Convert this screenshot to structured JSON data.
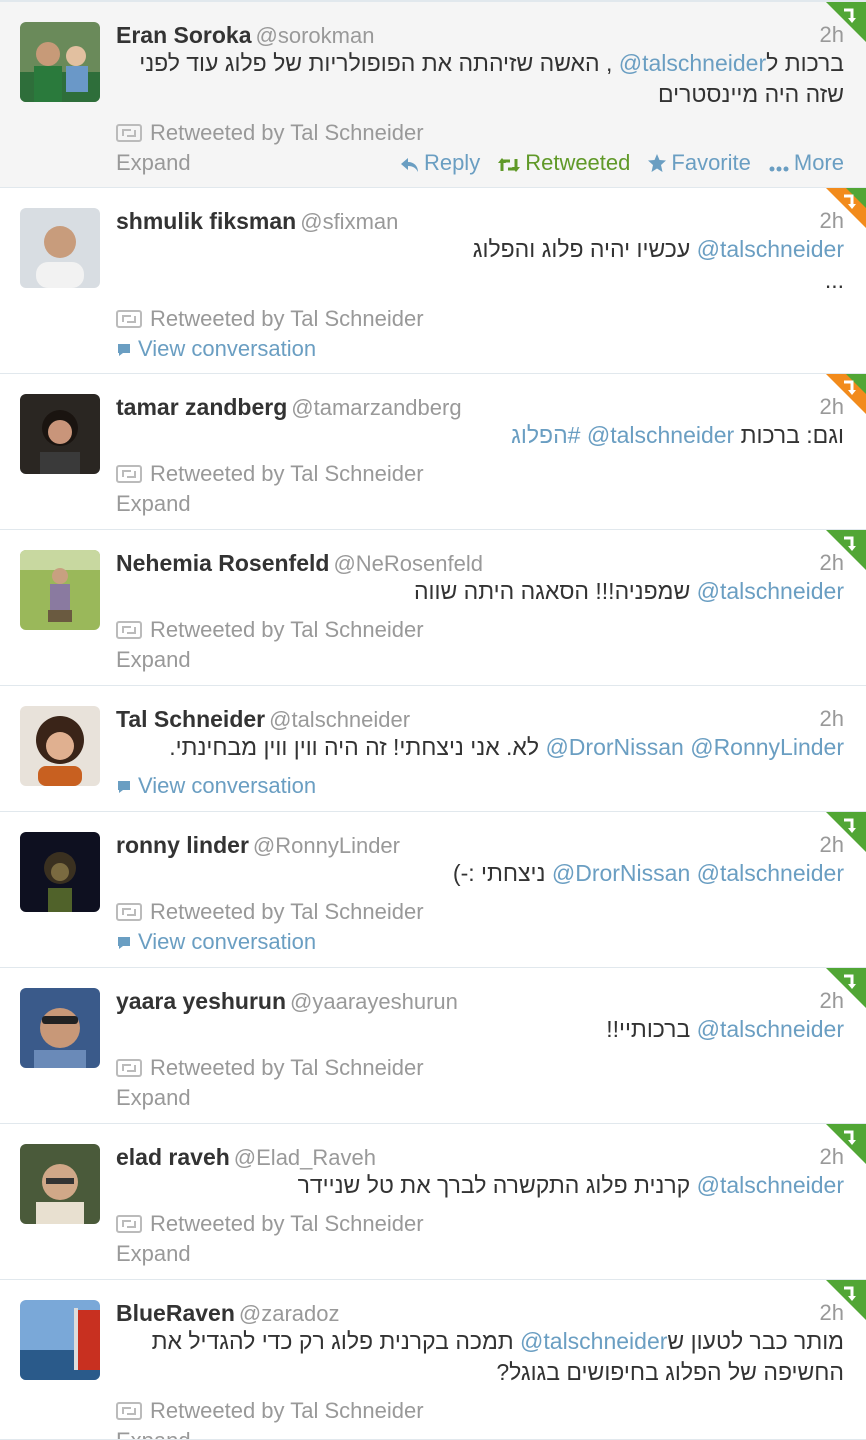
{
  "colors": {
    "link": "#6a9ec2",
    "retweeted": "#609928",
    "muted": "#999999",
    "badge_green": "#51a635",
    "badge_orange": "#f28b1c"
  },
  "tweets": [
    {
      "fullname": "Eran Soroka",
      "username": "@sorokman",
      "time": "2h",
      "lines": [
        [
          {
            "t": "text",
            "v": "ברכות ל"
          },
          {
            "t": "mention",
            "v": "@talschneider"
          },
          {
            "t": "text",
            "v": " , האשה שזיהתה את הפופולריות של פלוג עוד לפני"
          }
        ],
        [
          {
            "t": "text",
            "v": "שזה היה מיינסטרים"
          }
        ]
      ],
      "retweeted_by": "Retweeted by Tal Schneider",
      "link": "Expand",
      "link_kind": "expand",
      "expanded": true,
      "actions": {
        "reply": "Reply",
        "retweeted": "Retweeted",
        "favorite": "Favorite",
        "more": "More"
      },
      "badge": "green",
      "avatar_icon": "avatar-man-with-child-icon"
    },
    {
      "fullname": "shmulik fiksman",
      "username": "@sfixman",
      "time": "2h",
      "lines": [
        [
          {
            "t": "mention",
            "v": "@talschneider"
          },
          {
            "t": "text",
            "v": " עכשיו יהיה פלוג והפלוג"
          }
        ],
        [
          {
            "t": "text",
            "v": "..."
          }
        ]
      ],
      "retweeted_by": "Retweeted by Tal Schneider",
      "link": "View conversation",
      "link_kind": "conversation",
      "badge": "green-orange",
      "avatar_icon": "avatar-bald-man-icon"
    },
    {
      "fullname": "tamar zandberg",
      "username": "@tamarzandberg",
      "time": "2h",
      "lines": [
        [
          {
            "t": "text",
            "v": "וגם: ברכות "
          },
          {
            "t": "mention",
            "v": "@talschneider"
          },
          {
            "t": "text",
            "v": " "
          },
          {
            "t": "hashtag",
            "v": "#הפלוג"
          }
        ]
      ],
      "retweeted_by": "Retweeted by Tal Schneider",
      "link": "Expand",
      "link_kind": "expand",
      "badge": "green-orange",
      "avatar_icon": "avatar-woman-dark-hair-icon"
    },
    {
      "fullname": "Nehemia Rosenfeld",
      "username": "@NeRosenfeld",
      "time": "2h",
      "lines": [
        [
          {
            "t": "mention",
            "v": "@talschneider"
          },
          {
            "t": "text",
            "v": " שמפניה!!! הסאגה היתה שווה"
          }
        ]
      ],
      "retweeted_by": "Retweeted by Tal Schneider",
      "link": "Expand",
      "link_kind": "expand",
      "badge": "green",
      "avatar_icon": "avatar-man-in-field-icon"
    },
    {
      "fullname": "Tal Schneider",
      "username": "@talschneider",
      "time": "2h",
      "lines": [
        [
          {
            "t": "mention",
            "v": "@RonnyLinder"
          },
          {
            "t": "text",
            "v": " "
          },
          {
            "t": "mention",
            "v": "@DrorNissan"
          },
          {
            "t": "text",
            "v": " לא. אני ניצחתי! זה היה ווין ווין מבחינתי."
          }
        ]
      ],
      "retweeted_by": "",
      "link": "View conversation",
      "link_kind": "conversation",
      "badge": "none",
      "avatar_icon": "avatar-woman-curly-hair-icon"
    },
    {
      "fullname": "ronny linder",
      "username": "@RonnyLinder",
      "time": "2h",
      "lines": [
        [
          {
            "t": "mention",
            "v": "@talschneider"
          },
          {
            "t": "text",
            "v": " "
          },
          {
            "t": "mention",
            "v": "@DrorNissan"
          },
          {
            "t": "text",
            "v": " ניצחתי :-)"
          }
        ]
      ],
      "retweeted_by": "Retweeted by Tal Schneider",
      "link": "View conversation",
      "link_kind": "conversation",
      "badge": "green",
      "avatar_icon": "avatar-woman-dark-photo-icon"
    },
    {
      "fullname": "yaara yeshurun",
      "username": "@yaarayeshurun",
      "time": "2h",
      "lines": [
        [
          {
            "t": "mention",
            "v": "@talschneider"
          },
          {
            "t": "text",
            "v": " ברכותיי!!"
          }
        ]
      ],
      "retweeted_by": "Retweeted by Tal Schneider",
      "link": "Expand",
      "link_kind": "expand",
      "badge": "green",
      "avatar_icon": "avatar-woman-sunglasses-icon"
    },
    {
      "fullname": "elad raveh",
      "username": "@Elad_Raveh",
      "time": "2h",
      "lines": [
        [
          {
            "t": "mention",
            "v": "@talschneider"
          },
          {
            "t": "text",
            "v": " קרנית פלוג התקשרה לברך את טל שניידר"
          }
        ]
      ],
      "retweeted_by": "Retweeted by Tal Schneider",
      "link": "Expand",
      "link_kind": "expand",
      "badge": "green",
      "avatar_icon": "avatar-man-glasses-icon"
    },
    {
      "fullname": "BlueRaven",
      "username": "@zaradoz",
      "time": "2h",
      "lines": [
        [
          {
            "t": "text",
            "v": "מותר כבר לטעון ש"
          },
          {
            "t": "mention",
            "v": "@talschneider"
          },
          {
            "t": "text",
            "v": " תמכה בקרנית פלוג רק כדי להגדיל את"
          }
        ],
        [
          {
            "t": "text",
            "v": "החשיפה של הפלוג בחיפושים בגוגל?"
          }
        ]
      ],
      "retweeted_by": "Retweeted by Tal Schneider",
      "link": "Expand",
      "link_kind": "expand",
      "badge": "green",
      "avatar_icon": "avatar-sea-boat-icon"
    }
  ]
}
